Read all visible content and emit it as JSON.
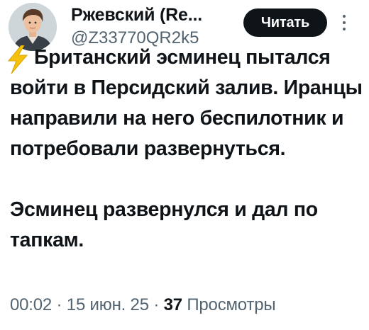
{
  "author": {
    "display_name": "Ржевский (Re...",
    "handle": "@Z33770QR2k5",
    "avatar_icon": "user-avatar"
  },
  "actions": {
    "read_label": "Читать",
    "more_icon": "more-vertical-icon"
  },
  "tweet": {
    "lead_icon": "lightning-bolt-icon",
    "paragraph1": "Британский эсминец пытался войти в Персидский залив. Иранцы направили на него беспилотник и потребовали развернуться.",
    "paragraph2": "Эсминец развернулся и дал по тапкам."
  },
  "meta": {
    "time": "00:02",
    "separator": "·",
    "date": "15 июн. 25",
    "views_count": "37",
    "views_label": "Просмотры"
  },
  "colors": {
    "text": "#0f1419",
    "secondary": "#536471",
    "button_bg": "#0f1419",
    "bolt": "#f4c20d"
  }
}
